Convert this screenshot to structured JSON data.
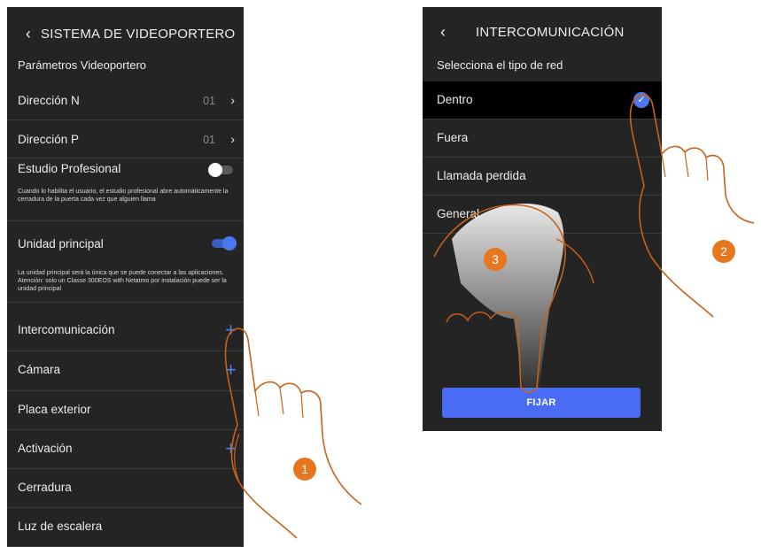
{
  "screen1": {
    "title": "SISTEMA DE VIDEOPORTERO",
    "back_icon": "chevron-left-icon",
    "section": "Parámetros Videoportero",
    "rows": [
      {
        "label": "Dirección N",
        "value": "01"
      },
      {
        "label": "Dirección P",
        "value": "01"
      }
    ],
    "studio": {
      "label": "Estudio Profesional",
      "state": "off",
      "desc": "Cuando lo habilita el usuario, el estudio profesional abre automáticamente la cerradura de la puerta cada vez que alguien llama"
    },
    "main_unit": {
      "label": "Unidad principal",
      "state": "on",
      "desc": "La unidad principal será la única que se puede conectar a las aplicaciones. Atención: solo un Classe 300EOS with Netatmo por instalación puede ser la unidad principal"
    },
    "items": [
      {
        "label": "Intercomunicación",
        "icon": "plus-icon"
      },
      {
        "label": "Cámara",
        "icon": "plus-icon"
      },
      {
        "label": "Placa exterior"
      },
      {
        "label": "Activación",
        "icon": "plus-icon"
      },
      {
        "label": "Cerradura"
      },
      {
        "label": "Luz de escalera"
      }
    ]
  },
  "screen2": {
    "title": "INTERCOMUNICACIÓN",
    "back_icon": "chevron-left-icon",
    "section": "Selecciona el tipo de red",
    "options": [
      {
        "label": "Dentro",
        "selected": true
      },
      {
        "label": "Fuera"
      },
      {
        "label": "Llamada perdida"
      },
      {
        "label": "General"
      }
    ],
    "button": "FIJAR"
  },
  "steps": [
    "1",
    "2",
    "3"
  ],
  "colors": {
    "screen_bg": "#242424",
    "accent": "#4a78f0",
    "button": "#4a6cf4",
    "badge": "#e8761e",
    "hand_outline": "#c8621a"
  }
}
